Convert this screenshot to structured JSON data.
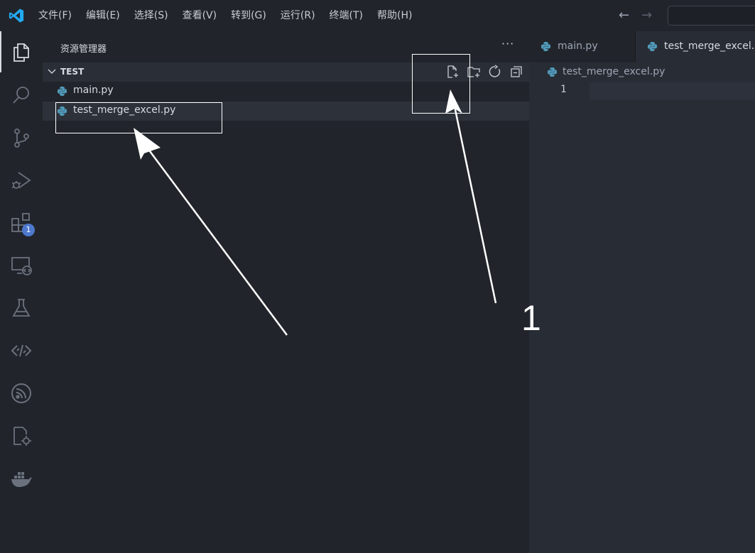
{
  "menu": {
    "items": [
      "文件(F)",
      "编辑(E)",
      "选择(S)",
      "查看(V)",
      "转到(G)",
      "运行(R)",
      "终端(T)",
      "帮助(H)"
    ]
  },
  "nav": {
    "back_icon": "←",
    "forward_icon": "→"
  },
  "activity_bar": {
    "icons": [
      "explorer-icon",
      "search-icon",
      "source-control-icon",
      "run-debug-icon",
      "extensions-icon",
      "remote-explorer-icon",
      "testing-icon",
      "api-icon",
      "esp-idf-icon",
      "device-settings-icon",
      "docker-icon"
    ],
    "extensions_badge": "1"
  },
  "sidebar": {
    "title": "资源管理器",
    "more": "···",
    "folder": {
      "name": "TEST",
      "actions": [
        "new-file-icon",
        "new-folder-icon",
        "refresh-icon",
        "collapse-all-icon"
      ]
    },
    "files": [
      {
        "name": "main.py",
        "selected": false
      },
      {
        "name": "test_merge_excel.py",
        "selected": true
      }
    ]
  },
  "editor": {
    "tabs": [
      {
        "label": "main.py",
        "active": false
      },
      {
        "label": "test_merge_excel.p",
        "active": true
      }
    ],
    "breadcrumb": "test_merge_excel.py",
    "line_number": "1"
  },
  "annotation": {
    "label": "1"
  },
  "colors": {
    "background": "#21252b",
    "editor_background": "#282c34",
    "python_icon": "#519aba",
    "vscode_logo": "#23a9f2",
    "badge": "#4d78cc"
  }
}
